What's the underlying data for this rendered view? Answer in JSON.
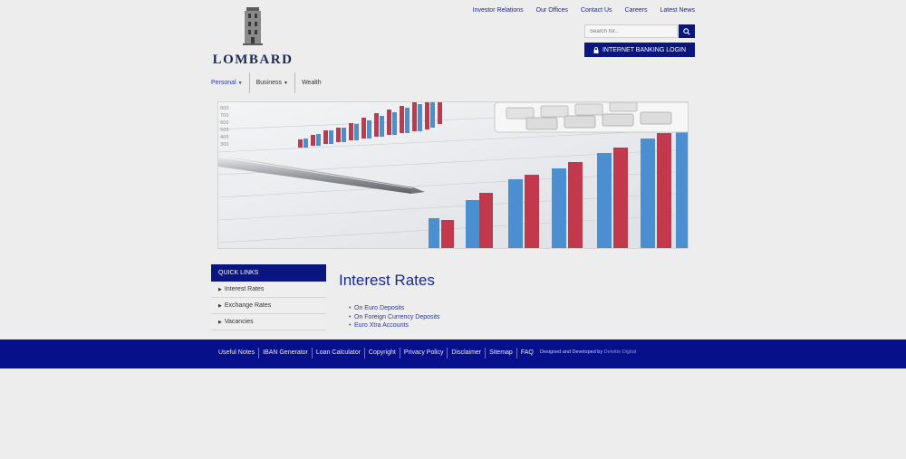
{
  "brand": {
    "name": "LOMBARD"
  },
  "top_links": [
    "Investor Relations",
    "Our Offices",
    "Contact Us",
    "Careers",
    "Latest News"
  ],
  "search": {
    "placeholder": "Search for..."
  },
  "login": {
    "label": "INTERNET BANKING LOGIN"
  },
  "main_nav": [
    {
      "label": "Personal",
      "dropdown": true
    },
    {
      "label": "Business",
      "dropdown": true
    },
    {
      "label": "Wealth",
      "dropdown": false
    }
  ],
  "quick_links": {
    "title": "QUICK LINKS",
    "items": [
      "Interest Rates",
      "Exchange Rates",
      "Vacancies"
    ]
  },
  "content": {
    "title": "Interest Rates",
    "links": [
      "On Euro Deposits",
      "On Foreign Currency Deposits",
      "Euro Xtra Accounts"
    ]
  },
  "footer": {
    "links": [
      "Useful Notes",
      "IBAN Generator",
      "Loan Calculator",
      "Copyright",
      "Privacy Policy",
      "Disclaimer",
      "Sitemap",
      "FAQ"
    ],
    "credit_prefix": "Designed and Developed by",
    "credit_name": "Deloitte Digital"
  },
  "colors": {
    "primary": "#0a1580",
    "link": "#1b2a7a",
    "footer_bg": "#06108a"
  }
}
